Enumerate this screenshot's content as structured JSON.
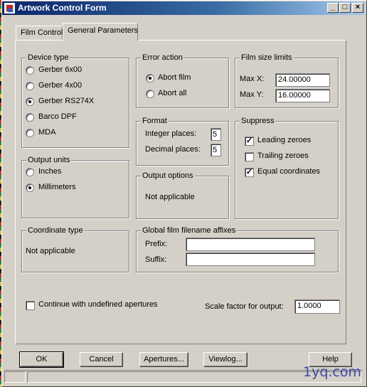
{
  "window": {
    "title": "Artwork Control Form"
  },
  "tabs": [
    {
      "label": "Film Control",
      "active": false
    },
    {
      "label": "General Parameters",
      "active": true
    }
  ],
  "device_type": {
    "legend": "Device type",
    "options": [
      "Gerber 6x00",
      "Gerber 4x00",
      "Gerber RS274X",
      "Barco DPF",
      "MDA"
    ],
    "selected": "Gerber RS274X"
  },
  "output_units": {
    "legend": "Output units",
    "options": [
      "Inches",
      "Millimeters"
    ],
    "selected": "Millimeters"
  },
  "coordinate_type": {
    "legend": "Coordinate type",
    "value": "Not applicable"
  },
  "error_action": {
    "legend": "Error action",
    "options": [
      "Abort film",
      "Abort all"
    ],
    "selected": "Abort film"
  },
  "format": {
    "legend": "Format",
    "integer_label": "Integer places:",
    "integer_value": "5",
    "decimal_label": "Decimal places:",
    "decimal_value": "5"
  },
  "output_options": {
    "legend": "Output options",
    "value": "Not applicable"
  },
  "film_size": {
    "legend": "Film size limits",
    "max_x_label": "Max X:",
    "max_x": "24.00000",
    "max_y_label": "Max Y:",
    "max_y": "16.00000"
  },
  "suppress": {
    "legend": "Suppress",
    "items": [
      {
        "label": "Leading zeroes",
        "checked": true
      },
      {
        "label": "Trailing zeroes",
        "checked": false
      },
      {
        "label": "Equal coordinates",
        "checked": true
      }
    ]
  },
  "affixes": {
    "legend": "Global film filename affixes",
    "prefix_label": "Prefix:",
    "prefix_value": "",
    "suffix_label": "Suffix:",
    "suffix_value": ""
  },
  "continue_undefined": {
    "label": "Continue with undefined apertures",
    "checked": false
  },
  "scale": {
    "label": "Scale factor for output:",
    "value": "1.0000"
  },
  "buttons": {
    "ok": "OK",
    "cancel": "Cancel",
    "apertures": "Apertures...",
    "viewlog": "Viewlog...",
    "help": "Help"
  },
  "watermark": "1yq.com",
  "colors": {
    "titlebar_start": "#0a246a",
    "titlebar_end": "#a6caf0",
    "dialog_face": "#d4d0c8"
  }
}
